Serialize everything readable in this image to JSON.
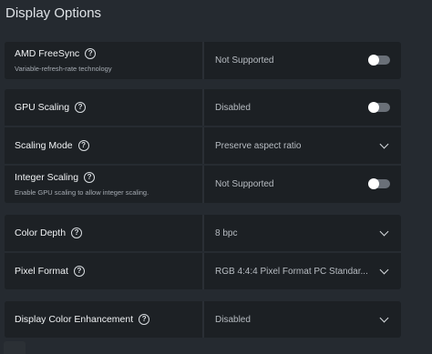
{
  "page_title": "Display Options",
  "help_glyph": "?",
  "groups": [
    {
      "rows": [
        {
          "label": "AMD FreeSync",
          "description": "Variable-refresh-rate technology",
          "value": "Not Supported",
          "control": "toggle",
          "state": "off"
        }
      ]
    },
    {
      "rows": [
        {
          "label": "GPU Scaling",
          "value": "Disabled",
          "control": "toggle",
          "state": "off"
        },
        {
          "label": "Scaling Mode",
          "value": "Preserve aspect ratio",
          "control": "dropdown"
        },
        {
          "label": "Integer Scaling",
          "description": "Enable GPU scaling to allow integer scaling.",
          "value": "Not Supported",
          "control": "toggle",
          "state": "off"
        }
      ]
    },
    {
      "rows": [
        {
          "label": "Color Depth",
          "value": "8 bpc",
          "control": "dropdown"
        },
        {
          "label": "Pixel Format",
          "value": "RGB 4:4:4 Pixel Format PC Standar...",
          "control": "dropdown"
        }
      ]
    },
    {
      "rows": [
        {
          "label": "Display Color Enhancement",
          "value": "Disabled",
          "control": "dropdown"
        }
      ]
    }
  ],
  "colors": {
    "background": "#252a30",
    "row": "#1c2024",
    "toggle_off": "#6a7078"
  }
}
